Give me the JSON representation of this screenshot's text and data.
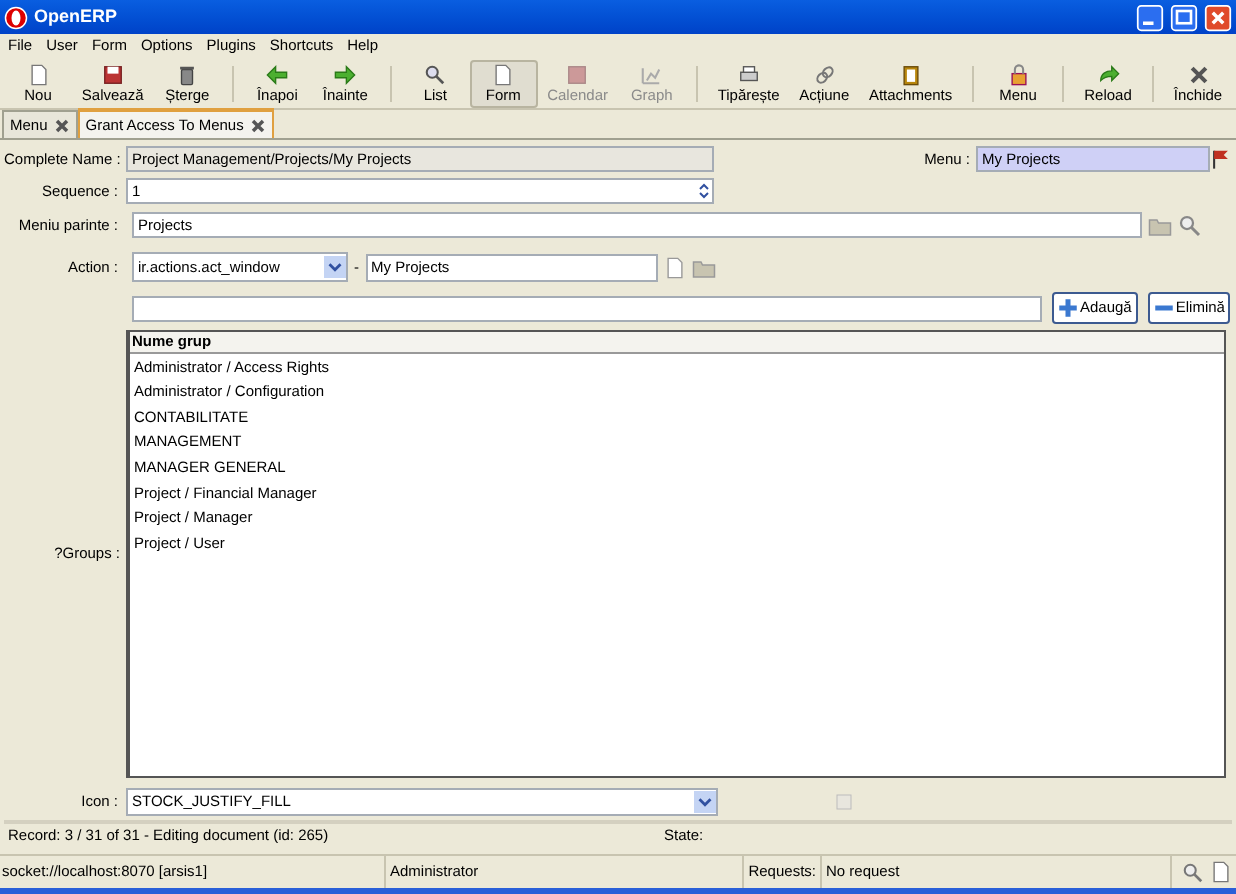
{
  "window": {
    "title": "OpenERP"
  },
  "menu_bar": [
    "File",
    "User",
    "Form",
    "Options",
    "Plugins",
    "Shortcuts",
    "Help"
  ],
  "toolbar": [
    {
      "label": "Nou",
      "selected": false,
      "disabled": false
    },
    {
      "label": "Salvează",
      "selected": false,
      "disabled": false
    },
    {
      "label": "Șterge",
      "selected": false,
      "disabled": false
    },
    {
      "label": "Înapoi",
      "selected": false,
      "disabled": false
    },
    {
      "label": "Înainte",
      "selected": false,
      "disabled": false
    },
    {
      "label": "List",
      "selected": false,
      "disabled": false
    },
    {
      "label": "Form",
      "selected": true,
      "disabled": false
    },
    {
      "label": "Calendar",
      "selected": false,
      "disabled": true
    },
    {
      "label": "Graph",
      "selected": false,
      "disabled": true
    },
    {
      "label": "Tipărește",
      "selected": false,
      "disabled": false
    },
    {
      "label": "Acțiune",
      "selected": false,
      "disabled": false
    },
    {
      "label": "Attachments",
      "selected": false,
      "disabled": false
    },
    {
      "label": "Menu",
      "selected": false,
      "disabled": false
    },
    {
      "label": "Reload",
      "selected": false,
      "disabled": false
    },
    {
      "label": "Închide",
      "selected": false,
      "disabled": false
    }
  ],
  "tabs": [
    {
      "label": "Menu",
      "selected": false
    },
    {
      "label": "Grant Access To Menus",
      "selected": true
    }
  ],
  "form": {
    "complete_name": {
      "label": "Complete Name :",
      "value": "Project Management/Projects/My Projects"
    },
    "menu": {
      "label": "Menu :",
      "value": "My Projects"
    },
    "sequence": {
      "label": "Sequence :",
      "value": "1"
    },
    "parent_menu": {
      "label": "Meniu parinte :",
      "value": "Projects"
    },
    "action": {
      "label": "Action :",
      "type": "ir.actions.act_window",
      "dash": "-",
      "value": "My Projects"
    },
    "groups": {
      "label": "?Groups :",
      "add_button": "Adaugă",
      "remove_button": "Elimină",
      "column": "Nume grup",
      "rows": [
        "Administrator / Access Rights",
        "Administrator / Configuration",
        "CONTABILITATE",
        "MANAGEMENT",
        "MANAGER GENERAL",
        "Project / Financial Manager",
        "Project / Manager",
        "Project / User"
      ]
    },
    "icon": {
      "label": "Icon :",
      "value": "STOCK_JUSTIFY_FILL"
    }
  },
  "record_bar": {
    "record": "Record: 3 / 31 of 31 - Editing document (id: 265)",
    "state_label": "State:"
  },
  "status_bar": {
    "server": "socket://localhost:8070 [arsis1]",
    "user": "Administrator",
    "requests_label": "Requests:",
    "requests": "No request"
  }
}
